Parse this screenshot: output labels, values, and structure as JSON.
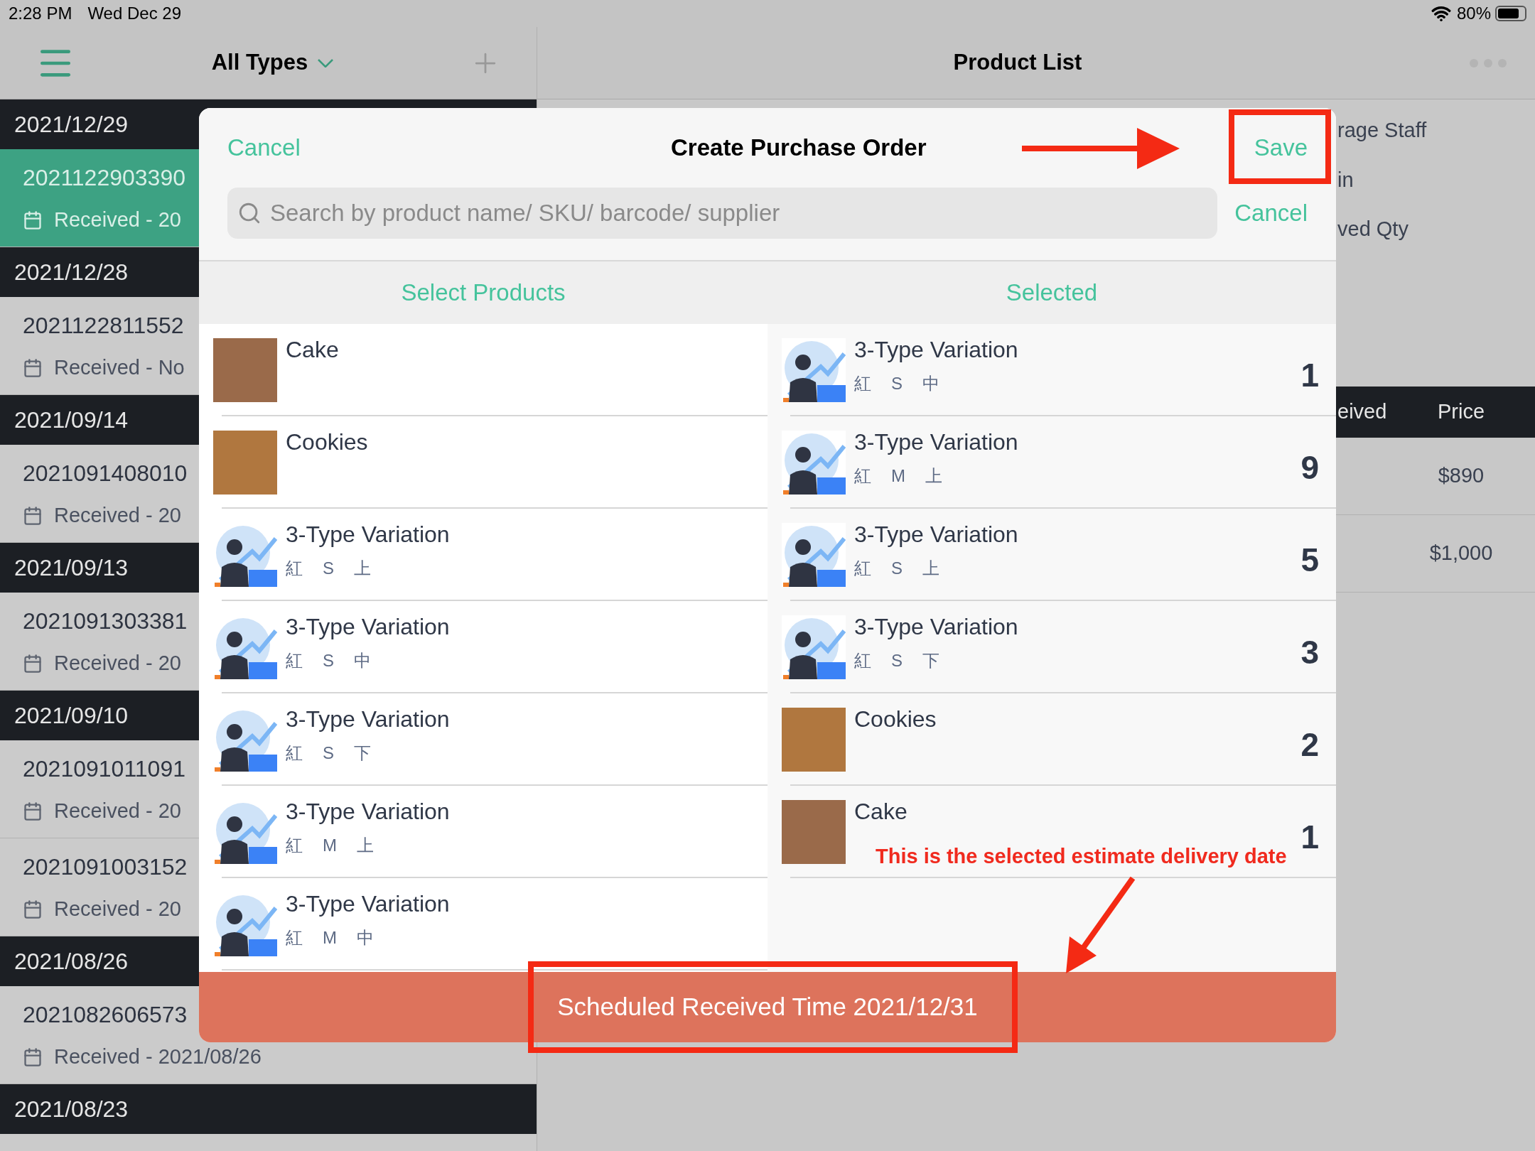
{
  "status_bar": {
    "time": "2:28 PM",
    "date": "Wed Dec 29",
    "battery": "80%"
  },
  "sidebar": {
    "filter": "All Types",
    "groups": [
      {
        "date": "2021/12/29",
        "orders": [
          {
            "number": "2021122903390",
            "status": "Received - 20",
            "selected": true
          }
        ]
      },
      {
        "date": "2021/12/28",
        "orders": [
          {
            "number": "2021122811552",
            "status": "Received - No",
            "selected": false
          }
        ]
      },
      {
        "date": "2021/09/14",
        "orders": [
          {
            "number": "2021091408010",
            "status": "Received - 20",
            "selected": false
          }
        ]
      },
      {
        "date": "2021/09/13",
        "orders": [
          {
            "number": "2021091303381",
            "status": "Received - 20",
            "selected": false
          }
        ]
      },
      {
        "date": "2021/09/10",
        "orders": [
          {
            "number": "2021091011091",
            "status": "Received - 20",
            "selected": false
          },
          {
            "number": "2021091003152",
            "status": "Received - 20",
            "selected": false
          }
        ]
      },
      {
        "date": "2021/08/26",
        "orders": [
          {
            "number": "2021082606573",
            "status": "Received - 2021/08/26",
            "selected": false
          }
        ]
      },
      {
        "date": "2021/08/23"
      }
    ]
  },
  "detail": {
    "title": "Product List",
    "info": [
      "rage Staff",
      "in",
      "ved Qty"
    ],
    "table": {
      "columns": [
        "eived",
        "Price"
      ],
      "rows": [
        {
          "price": "$890"
        },
        {
          "price": "$1,000"
        }
      ]
    }
  },
  "modal": {
    "cancel": "Cancel",
    "title": "Create Purchase Order",
    "save": "Save",
    "search": {
      "placeholder": "Search by product name/ SKU/ barcode/ supplier",
      "cancel": "Cancel"
    },
    "columns": [
      "Select Products",
      "Selected"
    ],
    "products": [
      {
        "name": "Cake",
        "kind": "cake"
      },
      {
        "name": "Cookies",
        "kind": "cookies"
      },
      {
        "name": "3-Type Variation",
        "kind": "illustration",
        "options": [
          "紅",
          "S",
          "上"
        ]
      },
      {
        "name": "3-Type Variation",
        "kind": "illustration",
        "options": [
          "紅",
          "S",
          "中"
        ]
      },
      {
        "name": "3-Type Variation",
        "kind": "illustration",
        "options": [
          "紅",
          "S",
          "下"
        ]
      },
      {
        "name": "3-Type Variation",
        "kind": "illustration",
        "options": [
          "紅",
          "M",
          "上"
        ]
      },
      {
        "name": "3-Type Variation",
        "kind": "illustration",
        "options": [
          "紅",
          "M",
          "中"
        ]
      }
    ],
    "selected": [
      {
        "name": "3-Type Variation",
        "kind": "illustration",
        "options": [
          "紅",
          "S",
          "中"
        ],
        "qty": "1"
      },
      {
        "name": "3-Type Variation",
        "kind": "illustration",
        "options": [
          "紅",
          "M",
          "上"
        ],
        "qty": "9"
      },
      {
        "name": "3-Type Variation",
        "kind": "illustration",
        "options": [
          "紅",
          "S",
          "上"
        ],
        "qty": "5"
      },
      {
        "name": "3-Type Variation",
        "kind": "illustration",
        "options": [
          "紅",
          "S",
          "下"
        ],
        "qty": "3"
      },
      {
        "name": "Cookies",
        "kind": "cookies",
        "qty": "2"
      },
      {
        "name": "Cake",
        "kind": "cake",
        "qty": "1"
      }
    ],
    "footer": "Scheduled Received Time 2021/12/31"
  },
  "annotation": {
    "note": "This is the selected estimate delivery date"
  }
}
